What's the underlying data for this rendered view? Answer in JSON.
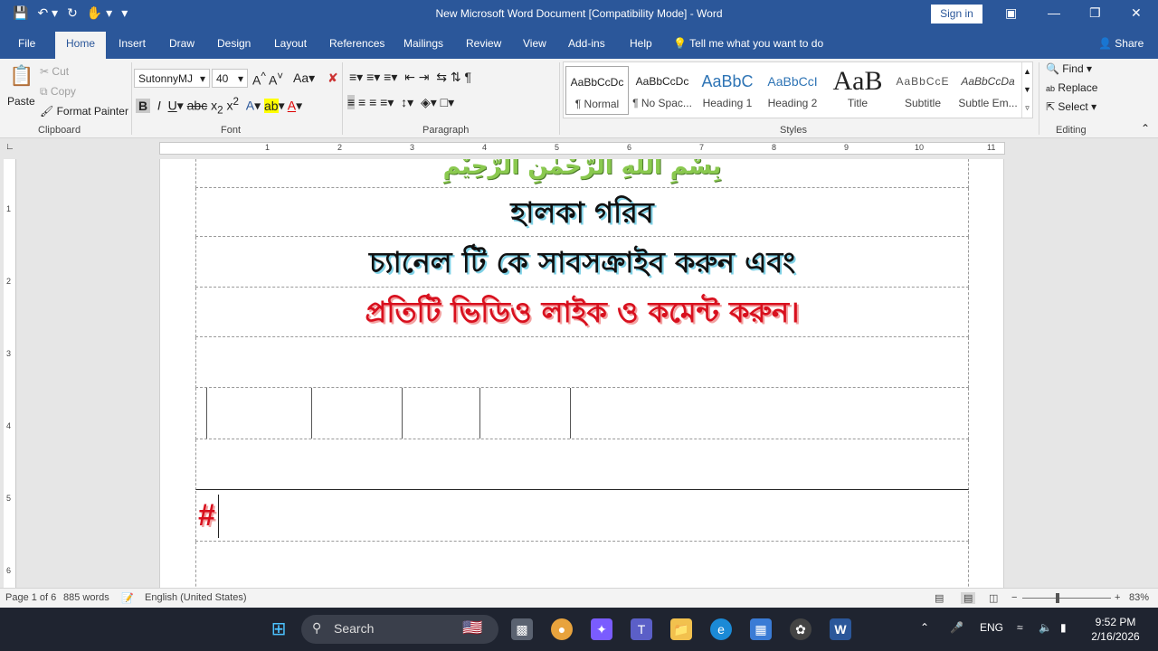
{
  "titlebar": {
    "title": "New Microsoft Word Document [Compatibility Mode]  -  Word",
    "signin": "Sign in",
    "icons": [
      "save-icon",
      "undo-icon",
      "redo-icon",
      "touch-mode-icon",
      "customize-icon"
    ]
  },
  "tabs": [
    "File",
    "Home",
    "Insert",
    "Draw",
    "Design",
    "Layout",
    "References",
    "Mailings",
    "Review",
    "View",
    "Add-ins",
    "Help"
  ],
  "tellme": "Tell me what you want to do",
  "share": "Share",
  "clipboard": {
    "paste": "Paste",
    "cut": "Cut",
    "copy": "Copy",
    "format_painter": "Format Painter",
    "label": "Clipboard"
  },
  "font": {
    "name": "SutonnyMJ",
    "size": "40",
    "label": "Font"
  },
  "paragraph": {
    "label": "Paragraph"
  },
  "styles": {
    "label": "Styles",
    "items": [
      {
        "preview": "AaBbCcDc",
        "name": "¶ Normal"
      },
      {
        "preview": "AaBbCcDc",
        "name": "¶ No Spac..."
      },
      {
        "preview": "AaBbC",
        "name": "Heading 1"
      },
      {
        "preview": "AaBbCcI",
        "name": "Heading 2"
      },
      {
        "preview": "AaB",
        "name": "Title"
      },
      {
        "preview": "AaBbCcE",
        "name": "Subtitle"
      },
      {
        "preview": "AaBbCcDa",
        "name": "Subtle Em..."
      }
    ]
  },
  "editing": {
    "find": "Find",
    "replace": "Replace",
    "select": "Select",
    "label": "Editing"
  },
  "ruler": [
    "1",
    "2",
    "3",
    "4",
    "5",
    "6",
    "7",
    "8",
    "9",
    "10",
    "11"
  ],
  "vruler": [
    "1",
    "2",
    "3",
    "4",
    "5",
    "6"
  ],
  "document": {
    "line0": "بِسْمِ اللهِ الرَّحْمٰنِ الرَّحِيْمِ",
    "line1": "হালকা গরিব",
    "line2": "চ্যানেল টি কে সাবসক্রাইব করুন এবং",
    "line3": "প্রতিটি ভিডিও লাইক ও কমেন্ট করুন।",
    "hash": "#"
  },
  "statusbar": {
    "page": "Page 1 of 6",
    "words": "885 words",
    "language": "English (United States)",
    "zoom": "83%"
  },
  "taskbar": {
    "search": "Search",
    "lang": "ENG",
    "time": "9:52 PM",
    "date": "2/16/2026"
  }
}
